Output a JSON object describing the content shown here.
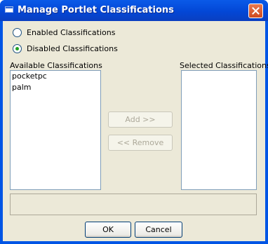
{
  "window": {
    "title": "Manage Portlet Classifications",
    "close_icon": "close-icon"
  },
  "options": [
    {
      "label": "Enabled Classifications",
      "checked": false
    },
    {
      "label": "Disabled Classifications",
      "checked": true
    }
  ],
  "available": {
    "label": "Available Classifications",
    "items": [
      "pocketpc",
      "palm"
    ]
  },
  "selected": {
    "label": "Selected Classifications",
    "items": []
  },
  "buttons": {
    "add": "Add >>",
    "remove": "<< Remove",
    "ok": "OK",
    "cancel": "Cancel"
  }
}
